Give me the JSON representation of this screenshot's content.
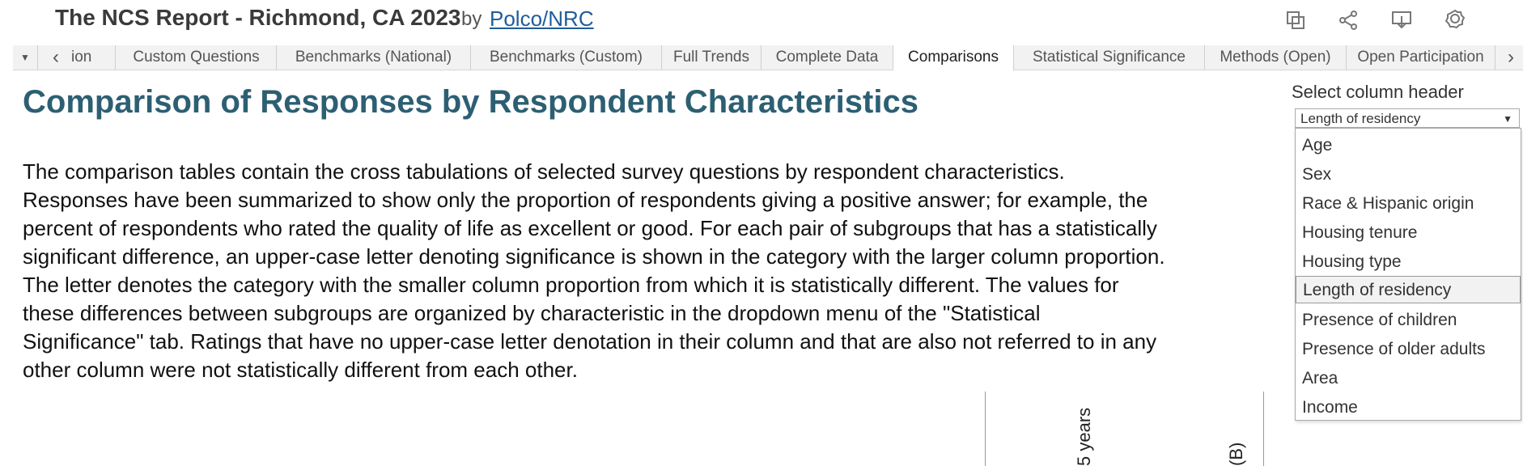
{
  "header": {
    "title": "The NCS Report - Richmond, CA 2023",
    "by": "by",
    "author": "Polco/NRC"
  },
  "toolbar": {
    "icons": [
      "duplicate-icon",
      "share-icon",
      "download-icon",
      "badge-icon"
    ]
  },
  "tabs": {
    "menu_glyph": "▼",
    "prev_glyph": "‹",
    "next_glyph": "›",
    "items": [
      {
        "label": "ion"
      },
      {
        "label": "Custom Questions"
      },
      {
        "label": "Benchmarks (National)"
      },
      {
        "label": "Benchmarks (Custom)"
      },
      {
        "label": "Full Trends"
      },
      {
        "label": "Complete Data"
      },
      {
        "label": "Comparisons",
        "active": true
      },
      {
        "label": "Statistical Significance"
      },
      {
        "label": "Methods (Open)"
      },
      {
        "label": "Open Participation"
      }
    ]
  },
  "main": {
    "heading": "Comparison of Responses by Respondent Characteristics",
    "paragraph_lines": [
      "The comparison tables contain the cross tabulations of selected survey questions by respondent characteristics.",
      "Responses have been summarized to show only the proportion of respondents giving a positive answer; for example, the",
      "percent of respondents who rated the quality of life as excellent or good. For each pair of subgroups that has a statistically",
      "significant difference, an upper-case letter denoting significance is shown in the category with the larger column proportion.",
      "The letter denotes the category with the smaller column proportion from which it is statistically different. The values for",
      "these differences between subgroups are organized by characteristic in the dropdown menu of the \"Statistical",
      "Significance\" tab. Ratings that have no upper-case letter denotation in their column and that are also not referred to in any",
      "other column were not statistically different from each other."
    ],
    "table_headers": [
      "5 years",
      "(B)"
    ]
  },
  "dropdown": {
    "label": "Select column header",
    "selected": "Length of residency",
    "arrow": "▼",
    "options": [
      "Age",
      "Sex",
      "Race & Hispanic origin",
      "Housing tenure",
      "Housing type",
      "Length of residency",
      "Presence of children",
      "Presence of older adults",
      "Area",
      "Income"
    ]
  },
  "colors": {
    "heading": "#2d5f73",
    "link": "#1f5c99"
  }
}
